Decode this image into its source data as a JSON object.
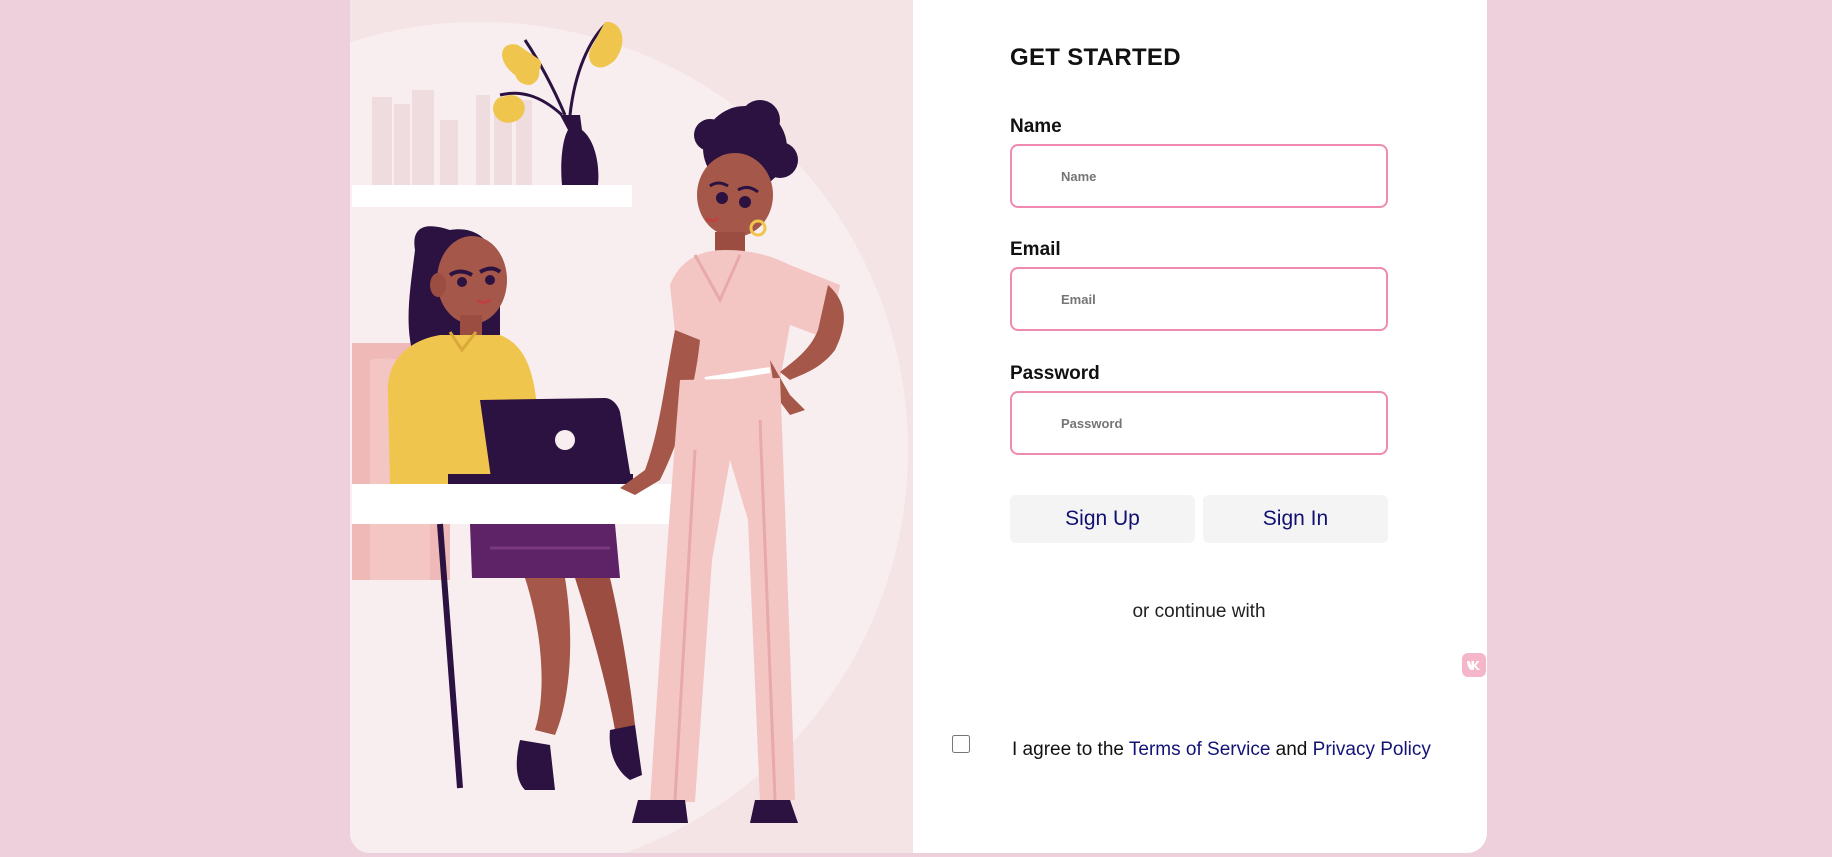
{
  "form": {
    "title": "GET STARTED",
    "name_label": "Name",
    "name_placeholder": "Name",
    "name_value": "",
    "email_label": "Email",
    "email_placeholder": "Email",
    "email_value": "",
    "password_label": "Password",
    "password_placeholder": "Password",
    "password_value": "",
    "signup_label": "Sign Up",
    "signin_label": "Sign In",
    "continue_text": "or continue with",
    "social": [
      {
        "icon": "vk-icon"
      },
      {
        "icon": "google-icon"
      },
      {
        "icon": "facebook-icon"
      }
    ],
    "agree_prefix": "I agree to the ",
    "terms_link": "Terms of Service",
    "agree_middle": " and ",
    "privacy_link": "Privacy Policy",
    "agree_checked": false
  },
  "colors": {
    "page_background": "#edd0dc",
    "input_border": "#f08ab0",
    "button_background": "#f4f4f5",
    "button_text": "#101070",
    "link": "#131377",
    "social_icon": "#f4b6c8"
  }
}
